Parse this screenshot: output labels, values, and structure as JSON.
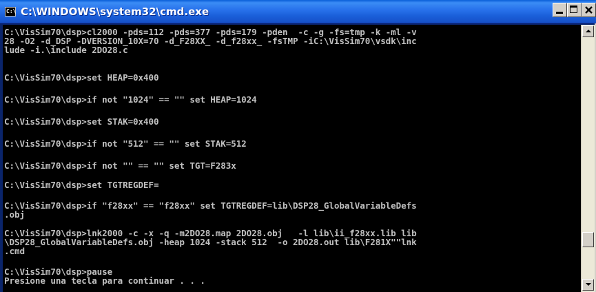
{
  "window": {
    "title": "C:\\WINDOWS\\system32\\cmd.exe",
    "icon": "cmd-console-icon",
    "icon_glyph": "C:\\",
    "controls": {
      "minimize_icon": "minimize-icon",
      "maximize_icon": "maximize-icon",
      "close_icon": "close-icon"
    }
  },
  "console": {
    "foreground_color": "#c0c0c0",
    "background_color": "#000000",
    "lines": [
      "C:\\VisSim70\\dsp>cl2000 -pds=112 -pds=377 -pds=179 -pden  -c -g -fs=tmp -k -ml -v",
      "28 -O2 -d_DSP -DVERSION_10X=70 -d_F28XX_ -d_f28xx_ -fsTMP -iC:\\VisSim70\\vsdk\\inc",
      "lude -i.\\include 2DO28.c",
      "",
      "C:\\VisSim70\\dsp>set HEAP=0x400",
      "",
      "C:\\VisSim70\\dsp>if not \"1024\" == \"\" set HEAP=1024",
      "",
      "C:\\VisSim70\\dsp>set STAK=0x400",
      "",
      "C:\\VisSim70\\dsp>if not \"512\" == \"\" set STAK=512",
      "",
      "C:\\VisSim70\\dsp>if not \"\" == \"\" set TGT=F283x",
      "",
      "C:\\VisSim70\\dsp>set TGTREGDEF=",
      "",
      "C:\\VisSim70\\dsp>if \"f28xx\" == \"f28xx\" set TGTREGDEF=lib\\DSP28_GlobalVariableDefs",
      ".obj",
      "",
      "C:\\VisSim70\\dsp>lnk2000 -c -x -q -m2DO28.map 2DO28.obj   -l lib\\ii_f28xx.lib lib",
      "\\DSP28_GlobalVariableDefs.obj -heap 1024 -stack 512  -o 2DO28.out lib\\F281X\"\"lnk",
      ".cmd",
      "",
      "C:\\VisSim70\\dsp>pause",
      "Presione una tecla para continuar . . ."
    ]
  },
  "scrollbar": {
    "up_icon": "scroll-up-arrow-icon",
    "down_icon": "scroll-down-arrow-icon",
    "position_fraction": 0.86
  }
}
